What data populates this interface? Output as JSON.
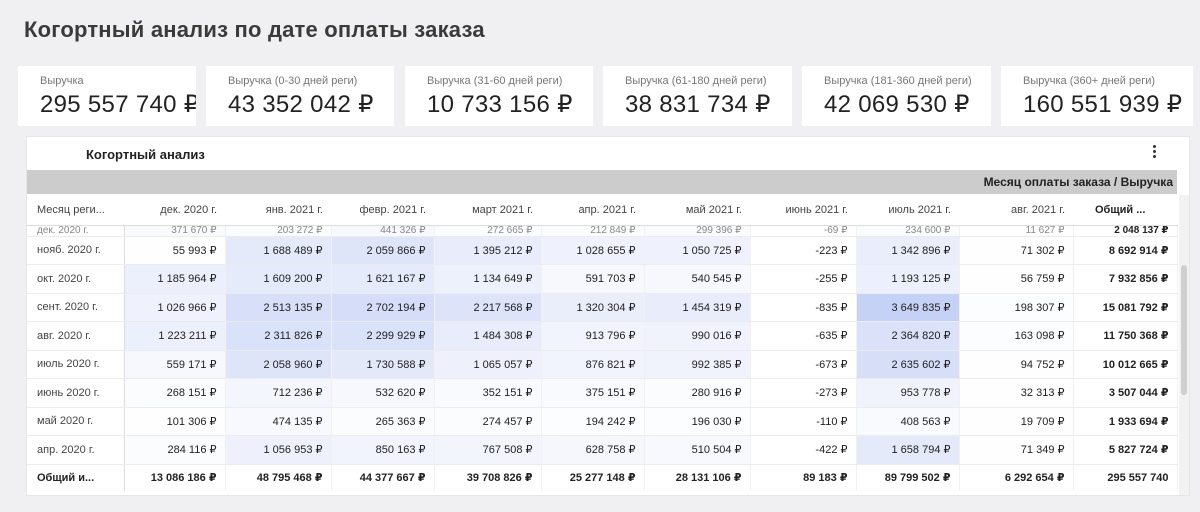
{
  "title": "Когортный анализ по дате оплаты заказа",
  "kpis": [
    {
      "label": "Выручка",
      "value": "295 557 740 ₽"
    },
    {
      "label": "Выручка (0-30 дней реги)",
      "value": "43 352 042 ₽"
    },
    {
      "label": "Выручка (31-60 дней реги)",
      "value": "10 733 156 ₽"
    },
    {
      "label": "Выручка (61-180 дней реги)",
      "value": "38 831 734 ₽"
    },
    {
      "label": "Выручка (181-360 дней реги)",
      "value": "42 069 530 ₽"
    },
    {
      "label": "Выручка (360+ дней реги)",
      "value": "160 551 939 ₽"
    }
  ],
  "panel": {
    "title": "Когортный анализ",
    "column_group_label": "Месяц оплаты заказа / Выручка",
    "row_header": "Месяц реги...",
    "columns": [
      "дек. 2020 г.",
      "янв. 2021 г.",
      "февр. 2021 г.",
      "март 2021 г.",
      "апр. 2021 г.",
      "май 2021 г.",
      "июнь 2021 г.",
      "июль 2021 г.",
      "авг. 2021 г."
    ],
    "total_header": "Общий ...",
    "cut_row": {
      "label": "дек. 2020 г.",
      "values": [
        "371 670 ₽",
        "203 272 ₽",
        "441 326 ₽",
        "272 665 ₽",
        "212 849 ₽",
        "299 396 ₽",
        "-69 ₽",
        "234 600 ₽",
        "11 627 ₽"
      ],
      "total": "2 048 137 ₽"
    },
    "rows": [
      {
        "label": "нояб. 2020 г.",
        "values": [
          "55 993 ₽",
          "1 688 489 ₽",
          "2 059 866 ₽",
          "1 395 212 ₽",
          "1 028 655 ₽",
          "1 050 725 ₽",
          "-223 ₽",
          "1 342 896 ₽",
          "71 302 ₽"
        ],
        "total": "8 692 914 ₽"
      },
      {
        "label": "окт. 2020 г.",
        "values": [
          "1 185 964 ₽",
          "1 609 200 ₽",
          "1 621 167 ₽",
          "1 134 649 ₽",
          "591 703 ₽",
          "540 545 ₽",
          "-255 ₽",
          "1 193 125 ₽",
          "56 759 ₽"
        ],
        "total": "7 932 856 ₽"
      },
      {
        "label": "сент. 2020 г.",
        "values": [
          "1 026 966 ₽",
          "2 513 135 ₽",
          "2 702 194 ₽",
          "2 217 568 ₽",
          "1 320 304 ₽",
          "1 454 319 ₽",
          "-835 ₽",
          "3 649 835 ₽",
          "198 307 ₽"
        ],
        "total": "15 081 792 ₽"
      },
      {
        "label": "авг. 2020 г.",
        "values": [
          "1 223 211 ₽",
          "2 311 826 ₽",
          "2 299 929 ₽",
          "1 484 308 ₽",
          "913 796 ₽",
          "990 016 ₽",
          "-635 ₽",
          "2 364 820 ₽",
          "163 098 ₽"
        ],
        "total": "11 750 368 ₽"
      },
      {
        "label": "июль 2020 г.",
        "values": [
          "559 171 ₽",
          "2 058 960 ₽",
          "1 730 588 ₽",
          "1 065 057 ₽",
          "876 821 ₽",
          "992 385 ₽",
          "-673 ₽",
          "2 635 602 ₽",
          "94 752 ₽"
        ],
        "total": "10 012 665 ₽"
      },
      {
        "label": "июнь 2020 г.",
        "values": [
          "268 151 ₽",
          "712 236 ₽",
          "532 620 ₽",
          "352 151 ₽",
          "375 151 ₽",
          "280 916 ₽",
          "-273 ₽",
          "953 778 ₽",
          "32 313 ₽"
        ],
        "total": "3 507 044 ₽"
      },
      {
        "label": "май 2020 г.",
        "values": [
          "101 306 ₽",
          "474 135 ₽",
          "265 363 ₽",
          "274 457 ₽",
          "194 242 ₽",
          "196 030 ₽",
          "-110 ₽",
          "408 563 ₽",
          "19 709 ₽"
        ],
        "total": "1 933 694 ₽"
      },
      {
        "label": "апр. 2020 г.",
        "values": [
          "284 116 ₽",
          "1 056 953 ₽",
          "850 163 ₽",
          "767 508 ₽",
          "628 758 ₽",
          "510 504 ₽",
          "-422 ₽",
          "1 658 794 ₽",
          "71 349 ₽"
        ],
        "total": "5 827 724 ₽"
      }
    ],
    "grand_total": {
      "label": "Общий и...",
      "values": [
        "13 086 186 ₽",
        "48 795 468 ₽",
        "44 377 667 ₽",
        "39 708 826 ₽",
        "25 277 148 ₽",
        "28 131 106 ₽",
        "89 183 ₽",
        "89 799 502 ₽",
        "6 292 654 ₽"
      ],
      "total": "295 557 740"
    },
    "heat_color": "#4c6fe0"
  }
}
